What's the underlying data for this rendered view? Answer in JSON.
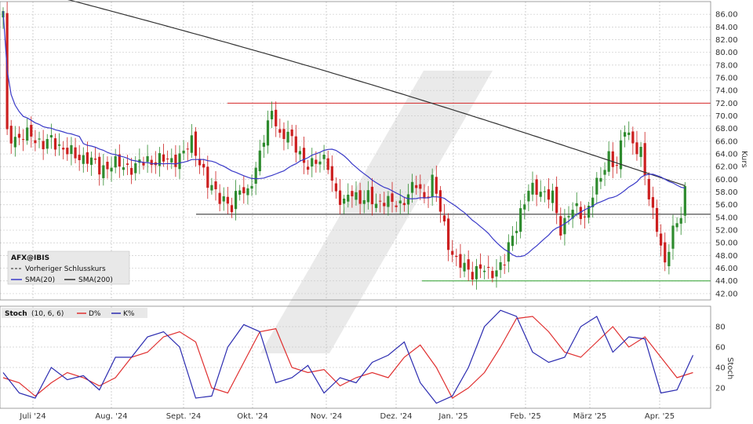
{
  "chart_data": [
    {
      "type": "candlestick",
      "title": "",
      "ylabel": "Kurs",
      "ylim": [
        41,
        88
      ],
      "yticks": [
        42,
        44,
        46,
        48,
        50,
        52,
        54,
        56,
        58,
        60,
        62,
        64,
        66,
        68,
        70,
        72,
        74,
        76,
        78,
        80,
        82,
        84,
        86
      ],
      "xticks": [
        "Juli '24",
        "Aug. '24",
        "Sept. '24",
        "Okt. '24",
        "Nov. '24",
        "Dez. '24",
        "Jan. '25",
        "Feb. '25",
        "März '25",
        "Apr. '25"
      ],
      "legend": {
        "symbol": "AFX@IBIS",
        "prev_close": "Vorheriger Schlusskurs",
        "sma20": "SMA(20)",
        "sma200": "SMA(200)"
      },
      "close_approx": [
        [
          0,
          86
        ],
        [
          1,
          67
        ],
        [
          4,
          66.5
        ],
        [
          7,
          67
        ],
        [
          10,
          65.5
        ],
        [
          12,
          66
        ],
        [
          15,
          65
        ],
        [
          18,
          63.5
        ],
        [
          21,
          63.5
        ],
        [
          24,
          61.5
        ],
        [
          27,
          62.5
        ],
        [
          30,
          62
        ],
        [
          33,
          62
        ],
        [
          36,
          63
        ],
        [
          39,
          63
        ],
        [
          42,
          63
        ],
        [
          45,
          64
        ],
        [
          47,
          66
        ],
        [
          49,
          63
        ],
        [
          51,
          59
        ],
        [
          53,
          58
        ],
        [
          55,
          57
        ],
        [
          57,
          55
        ],
        [
          59,
          59
        ],
        [
          61,
          58
        ],
        [
          63,
          61
        ],
        [
          65,
          67
        ],
        [
          67,
          71
        ],
        [
          69,
          66
        ],
        [
          71,
          68
        ],
        [
          73,
          65
        ],
        [
          75,
          62
        ],
        [
          77,
          63
        ],
        [
          79,
          63
        ],
        [
          81,
          62
        ],
        [
          83,
          58
        ],
        [
          85,
          56
        ],
        [
          87,
          58
        ],
        [
          89,
          57
        ],
        [
          91,
          57
        ],
        [
          93,
          56
        ],
        [
          95,
          57
        ],
        [
          97,
          56
        ],
        [
          99,
          56
        ],
        [
          101,
          58
        ],
        [
          103,
          59
        ],
        [
          105,
          57
        ],
        [
          107,
          60
        ],
        [
          109,
          55
        ],
        [
          111,
          50
        ],
        [
          113,
          47
        ],
        [
          115,
          46
        ],
        [
          117,
          45.5
        ],
        [
          119,
          46
        ],
        [
          121,
          45
        ],
        [
          123,
          46
        ],
        [
          125,
          47
        ],
        [
          127,
          51
        ],
        [
          129,
          55
        ],
        [
          131,
          58
        ],
        [
          133,
          58.5
        ],
        [
          135,
          58
        ],
        [
          137,
          57
        ],
        [
          139,
          52
        ],
        [
          141,
          55
        ],
        [
          143,
          55
        ],
        [
          145,
          54
        ],
        [
          147,
          58
        ],
        [
          149,
          60
        ],
        [
          151,
          64
        ],
        [
          153,
          62
        ],
        [
          155,
          68
        ],
        [
          157,
          66
        ],
        [
          159,
          64
        ],
        [
          161,
          57
        ],
        [
          163,
          53
        ],
        [
          165,
          46
        ],
        [
          167,
          52
        ],
        [
          169,
          55
        ],
        [
          170,
          58
        ]
      ],
      "horizontal_lines": [
        {
          "value": 72,
          "color": "#d62728"
        },
        {
          "value": 54.5,
          "color": "#222222"
        },
        {
          "value": 44,
          "color": "#2ca02c"
        }
      ],
      "colors": {
        "up": "#2e8b2e",
        "down": "#cc1f1f",
        "sma20": "#3a3ac8",
        "sma200": "#333333"
      }
    },
    {
      "type": "line",
      "title": "Stoch",
      "params": "(10, 6, 6)",
      "ylabel": "Stoch",
      "ylim": [
        0,
        100
      ],
      "yticks": [
        20,
        40,
        60,
        80
      ],
      "series": [
        {
          "name": "D%",
          "color": "#e03030",
          "values": [
            [
              0,
              30
            ],
            [
              4,
              25
            ],
            [
              8,
              12
            ],
            [
              12,
              25
            ],
            [
              16,
              35
            ],
            [
              20,
              30
            ],
            [
              24,
              22
            ],
            [
              28,
              30
            ],
            [
              32,
              50
            ],
            [
              36,
              55
            ],
            [
              40,
              70
            ],
            [
              44,
              75
            ],
            [
              48,
              65
            ],
            [
              52,
              20
            ],
            [
              56,
              15
            ],
            [
              60,
              45
            ],
            [
              64,
              75
            ],
            [
              68,
              78
            ],
            [
              72,
              40
            ],
            [
              76,
              35
            ],
            [
              80,
              38
            ],
            [
              84,
              22
            ],
            [
              88,
              30
            ],
            [
              92,
              35
            ],
            [
              96,
              30
            ],
            [
              100,
              50
            ],
            [
              104,
              62
            ],
            [
              108,
              40
            ],
            [
              112,
              10
            ],
            [
              116,
              20
            ],
            [
              120,
              35
            ],
            [
              124,
              60
            ],
            [
              128,
              88
            ],
            [
              132,
              90
            ],
            [
              136,
              75
            ],
            [
              140,
              55
            ],
            [
              144,
              50
            ],
            [
              148,
              65
            ],
            [
              152,
              80
            ],
            [
              156,
              60
            ],
            [
              160,
              70
            ],
            [
              164,
              50
            ],
            [
              168,
              30
            ],
            [
              172,
              35
            ]
          ]
        },
        {
          "name": "K%",
          "color": "#2b2bb0",
          "values": [
            [
              0,
              35
            ],
            [
              4,
              15
            ],
            [
              8,
              10
            ],
            [
              12,
              40
            ],
            [
              16,
              28
            ],
            [
              20,
              32
            ],
            [
              24,
              18
            ],
            [
              28,
              50
            ],
            [
              32,
              50
            ],
            [
              36,
              70
            ],
            [
              40,
              75
            ],
            [
              44,
              60
            ],
            [
              48,
              10
            ],
            [
              52,
              12
            ],
            [
              56,
              60
            ],
            [
              60,
              82
            ],
            [
              64,
              75
            ],
            [
              68,
              25
            ],
            [
              72,
              30
            ],
            [
              76,
              42
            ],
            [
              80,
              15
            ],
            [
              84,
              30
            ],
            [
              88,
              25
            ],
            [
              92,
              45
            ],
            [
              96,
              52
            ],
            [
              100,
              65
            ],
            [
              104,
              25
            ],
            [
              108,
              5
            ],
            [
              112,
              12
            ],
            [
              116,
              40
            ],
            [
              120,
              80
            ],
            [
              124,
              96
            ],
            [
              128,
              90
            ],
            [
              132,
              55
            ],
            [
              136,
              45
            ],
            [
              140,
              50
            ],
            [
              144,
              80
            ],
            [
              148,
              90
            ],
            [
              152,
              55
            ],
            [
              156,
              70
            ],
            [
              160,
              68
            ],
            [
              164,
              15
            ],
            [
              168,
              18
            ],
            [
              172,
              52
            ]
          ]
        }
      ]
    }
  ]
}
